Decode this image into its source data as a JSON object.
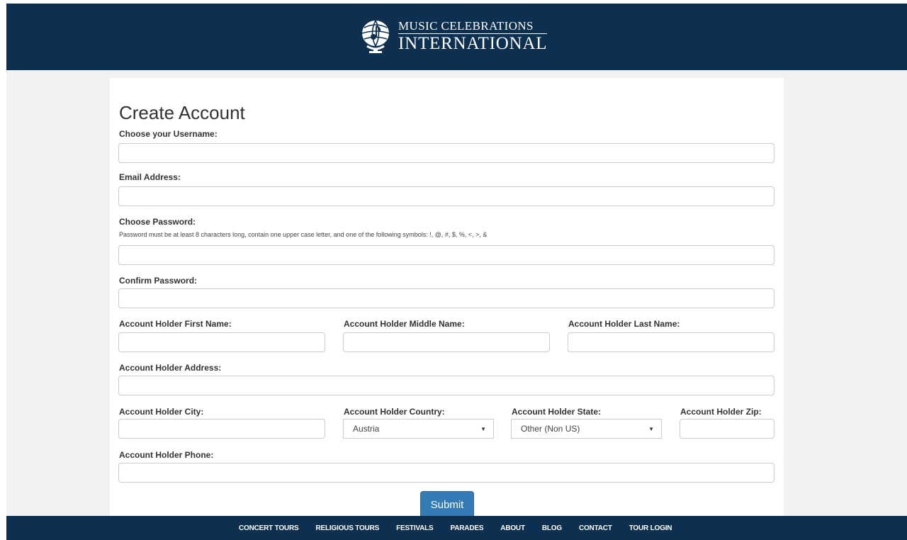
{
  "header": {
    "logo_line1": "Music Celebrations",
    "logo_line2": "INTERNATIONAL"
  },
  "form": {
    "title": "Create Account",
    "username_label": "Choose your Username:",
    "username_value": "",
    "email_label": "Email Address:",
    "email_value": "",
    "password_label": "Choose Password:",
    "password_hint": "Password must be at least 8 characters long, contain one upper case letter, and one of the following symbols: !, @, #, $, %, <, >, &",
    "password_value": "",
    "confirm_label": "Confirm Password:",
    "confirm_value": "",
    "first_name_label": "Account Holder First Name:",
    "middle_name_label": "Account Holder Middle Name:",
    "last_name_label": "Account Holder Last Name:",
    "address_label": "Account Holder Address:",
    "city_label": "Account Holder City:",
    "country_label": "Account Holder Country:",
    "country_value": "Austria",
    "state_label": "Account Holder State:",
    "state_value": "Other (Non US)",
    "zip_label": "Account Holder Zip:",
    "phone_label": "Account Holder Phone:",
    "submit_label": "Submit"
  },
  "footer": {
    "nav": [
      "CONCERT TOURS",
      "RELIGIOUS TOURS",
      "FESTIVALS",
      "PARADES",
      "ABOUT",
      "BLOG",
      "CONTACT",
      "TOUR LOGIN"
    ]
  },
  "colors": {
    "header_bg": "#0d3050",
    "page_bg": "#f2f2f2",
    "button": "#337ab7"
  }
}
